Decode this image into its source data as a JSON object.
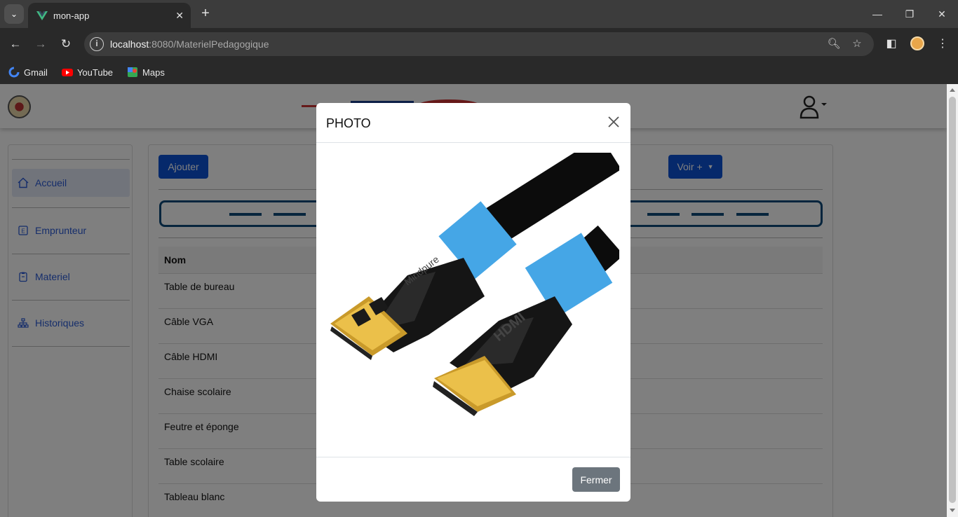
{
  "browser": {
    "tab_title": "mon-app",
    "url_host": "localhost",
    "url_path": ":8080/MaterielPedagogique",
    "bookmarks": [
      "Gmail",
      "YouTube",
      "Maps"
    ]
  },
  "sidebar": {
    "items": [
      {
        "label": "Accueil",
        "icon": "home-icon",
        "active": true
      },
      {
        "label": "Emprunteur",
        "icon": "id-card-icon",
        "active": false
      },
      {
        "label": "Materiel",
        "icon": "clipboard-icon",
        "active": false
      },
      {
        "label": "Historiques",
        "icon": "sitemap-icon",
        "active": false
      }
    ]
  },
  "content": {
    "add_button": "Ajouter",
    "more_button": "Voir +",
    "table_header": "Nom",
    "rows": [
      "Table de bureau",
      "Câble VGA",
      "Câble HDMI",
      "Chaise scolaire",
      "Feutre et éponge",
      "Table scolaire",
      "Tableau blanc"
    ]
  },
  "modal": {
    "title": "PHOTO",
    "close_button": "Fermer",
    "photo_brand_text": "Mindpure",
    "photo_plug_text": "HDMI"
  },
  "colors": {
    "primary": "#0d52d6",
    "secondary": "#6c757d",
    "pager_border": "#0f4a7a",
    "sidebar_link": "#2a5bd7",
    "cable_accent": "#45a6e6"
  }
}
